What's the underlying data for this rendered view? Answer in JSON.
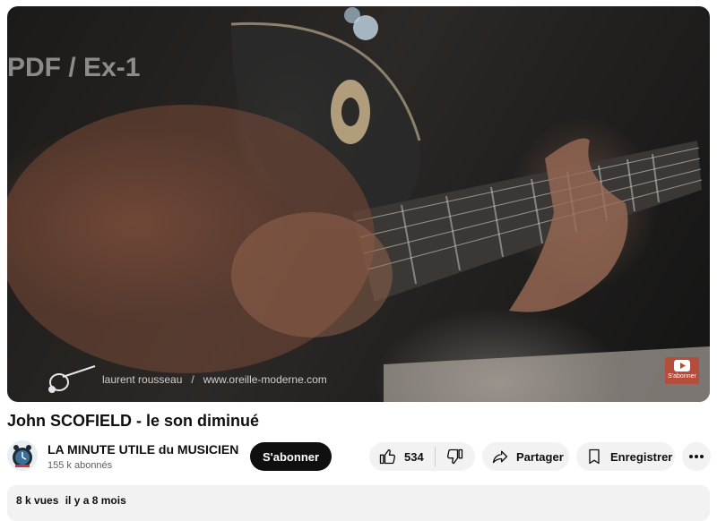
{
  "video": {
    "overlay_text": "PDF / Ex-1",
    "credit_name": "laurent rousseau",
    "credit_separator": "/",
    "credit_url": "www.oreille-moderne.com",
    "subscribe_badge_label": "S'abonner"
  },
  "title": "John SCOFIELD - le son diminué",
  "channel": {
    "name": "LA MINUTE UTILE du MUSICIEN",
    "subscribers": "155 k abonnés",
    "subscribe_label": "S'abonner"
  },
  "actions": {
    "like_count": "534",
    "share_label": "Partager",
    "save_label": "Enregistrer",
    "like_icon": "thumbs-up-icon",
    "dislike_icon": "thumbs-down-icon",
    "share_icon": "share-arrow-icon",
    "save_icon": "bookmark-icon",
    "more_icon": "more-horizontal-icon"
  },
  "description": {
    "views": "8 k vues",
    "date": "il y a 8 mois"
  },
  "colors": {
    "subscribe_bg": "#0f0f0f",
    "pill_bg": "#f2f2f2",
    "badge_bg": "#be4632"
  }
}
